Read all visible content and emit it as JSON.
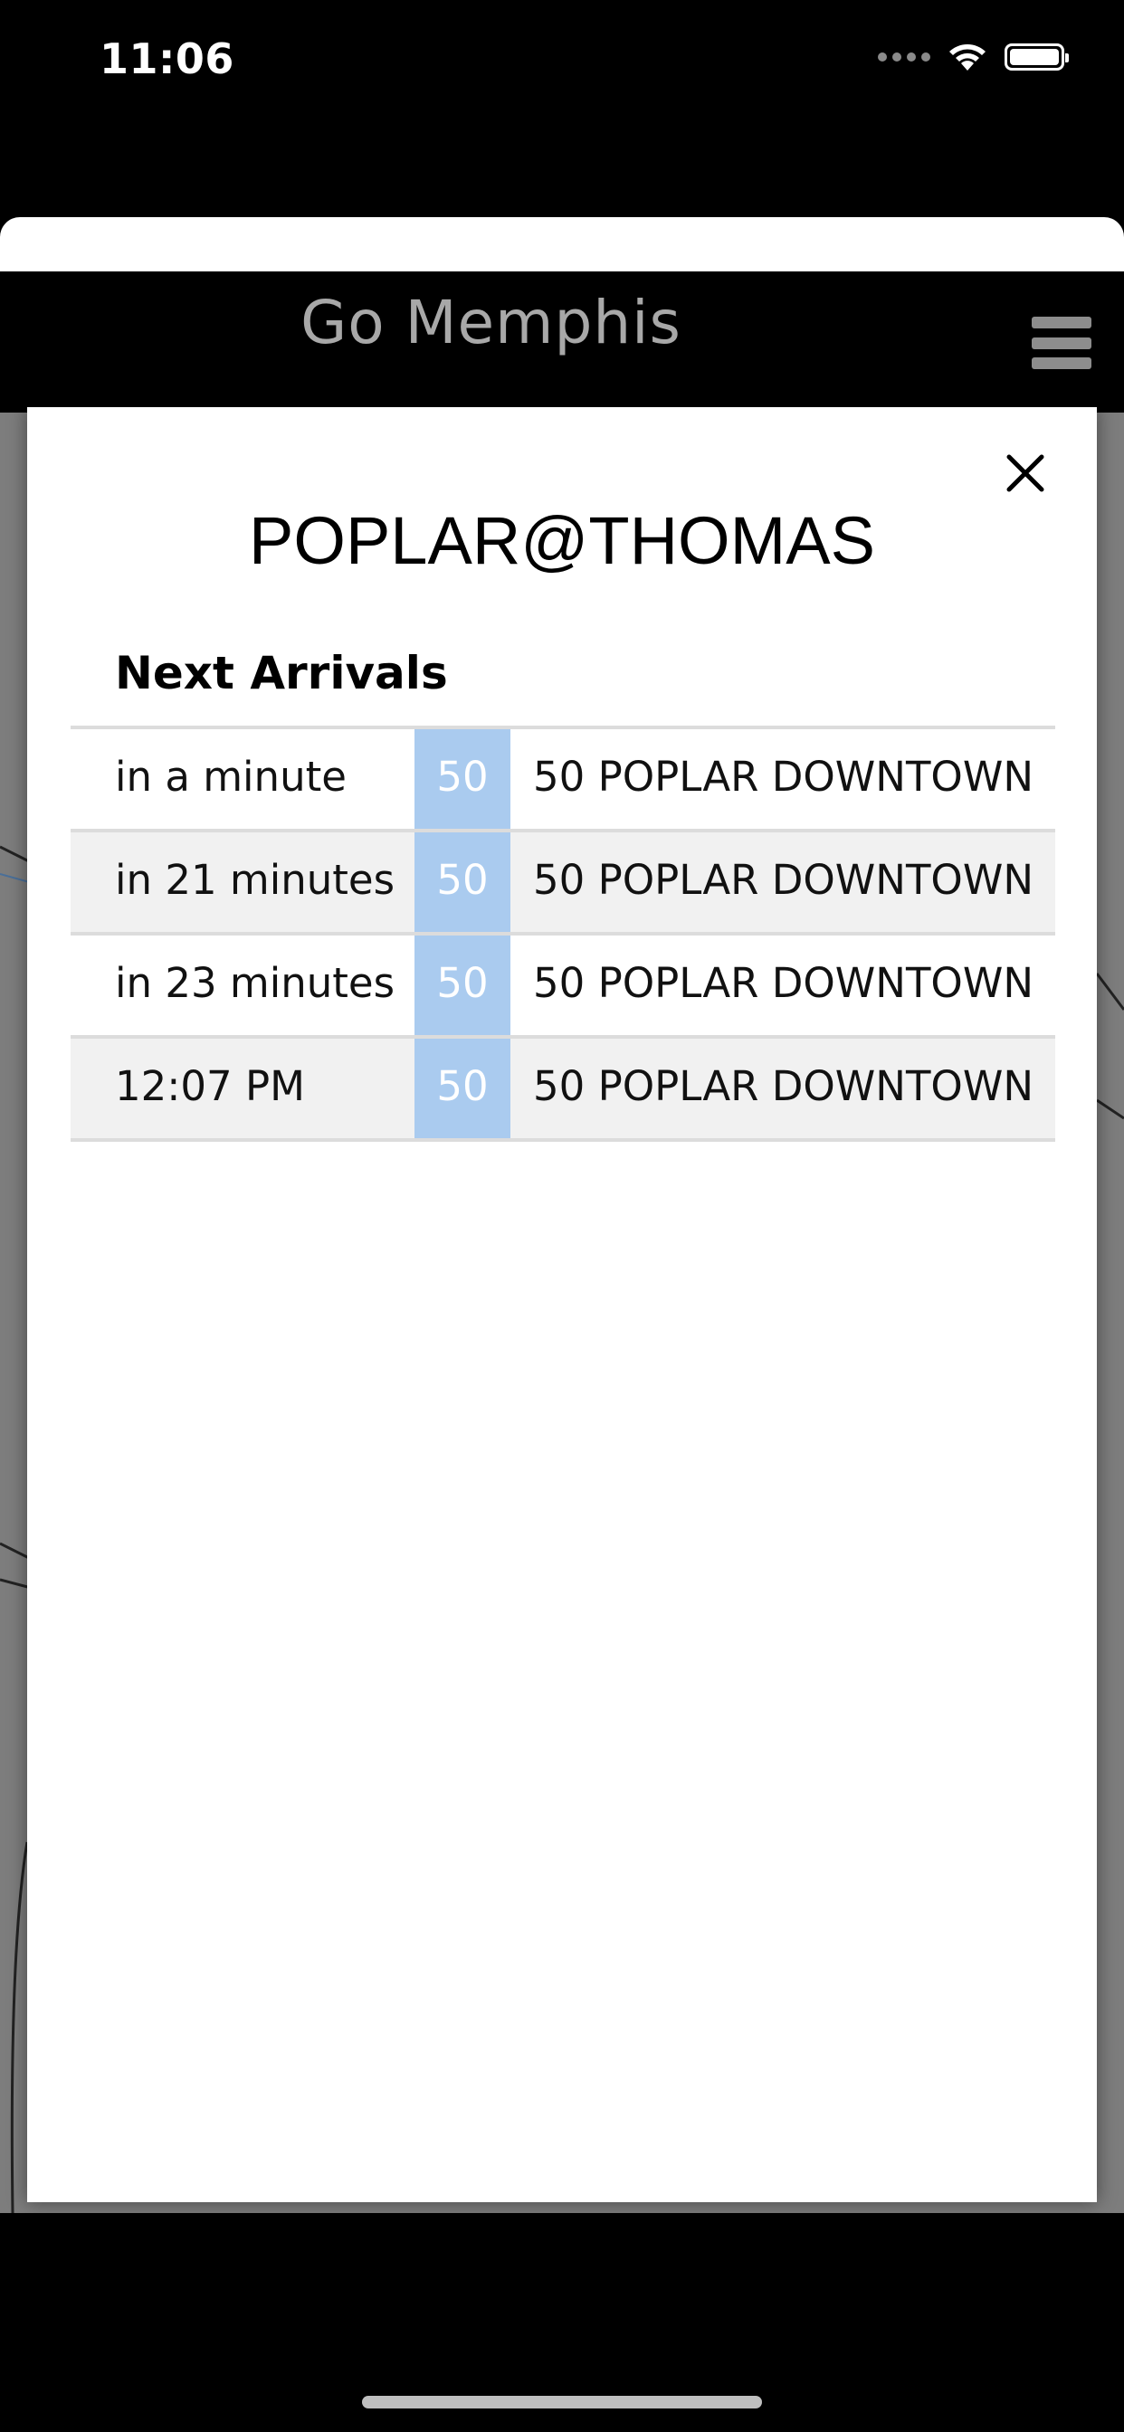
{
  "status_bar": {
    "time": "11:06"
  },
  "app": {
    "title": "Go Memphis"
  },
  "modal": {
    "stop_name": "POPLAR@THOMAS",
    "section_heading": "Next Arrivals",
    "arrivals": [
      {
        "time": "in a minute",
        "route": "50",
        "destination": "50 POPLAR DOWNTOWN"
      },
      {
        "time": "in 21 minutes",
        "route": "50",
        "destination": "50 POPLAR DOWNTOWN"
      },
      {
        "time": "in 23 minutes",
        "route": "50",
        "destination": "50 POPLAR DOWNTOWN"
      },
      {
        "time": "12:07 PM",
        "route": "50",
        "destination": "50 POPLAR DOWNTOWN"
      }
    ]
  },
  "icons": {
    "signal": "cellular-signal-icon",
    "wifi": "wifi-icon",
    "battery": "battery-icon",
    "menu": "hamburger-menu-icon",
    "close": "close-icon"
  },
  "colors": {
    "route_badge": "#aacbef",
    "alt_row": "#f1f1f1",
    "header_bg": "#000000",
    "title_text": "#a8a8a8"
  }
}
